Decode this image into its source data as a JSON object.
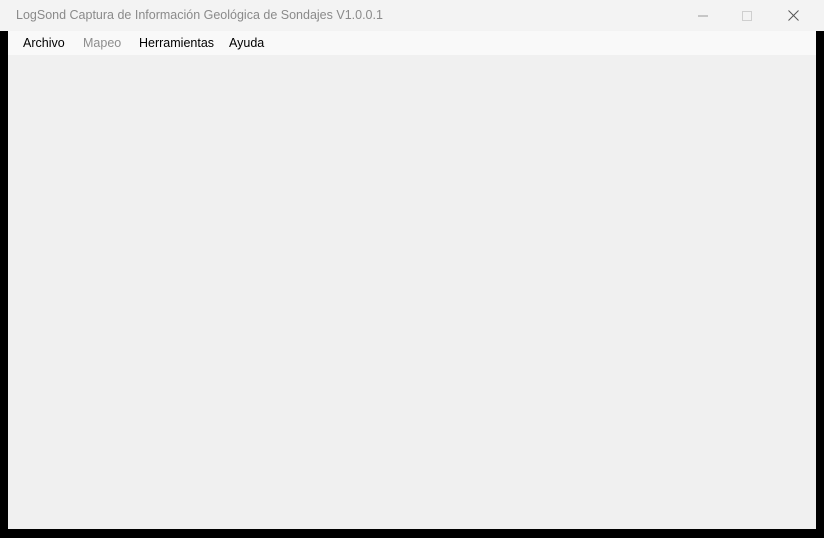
{
  "window": {
    "title": "LogSond Captura de Información Geológica de Sondajes V1.0.0.1",
    "controls": {
      "minimize_icon": "minimize-icon",
      "maximize_icon": "maximize-icon",
      "close_icon": "close-icon"
    }
  },
  "menu": {
    "items": [
      {
        "label": "Archivo",
        "enabled": true
      },
      {
        "label": "Mapeo",
        "enabled": false
      },
      {
        "label": "Herramientas",
        "enabled": true
      },
      {
        "label": "Ayuda",
        "enabled": true
      }
    ]
  },
  "colors": {
    "titlebar_bg": "#f3f3f3",
    "title_text": "#8a8a8a",
    "menubar_bg": "#f9f9f9",
    "client_bg": "#f0f0f0",
    "disabled_text": "#8d8d8d"
  }
}
